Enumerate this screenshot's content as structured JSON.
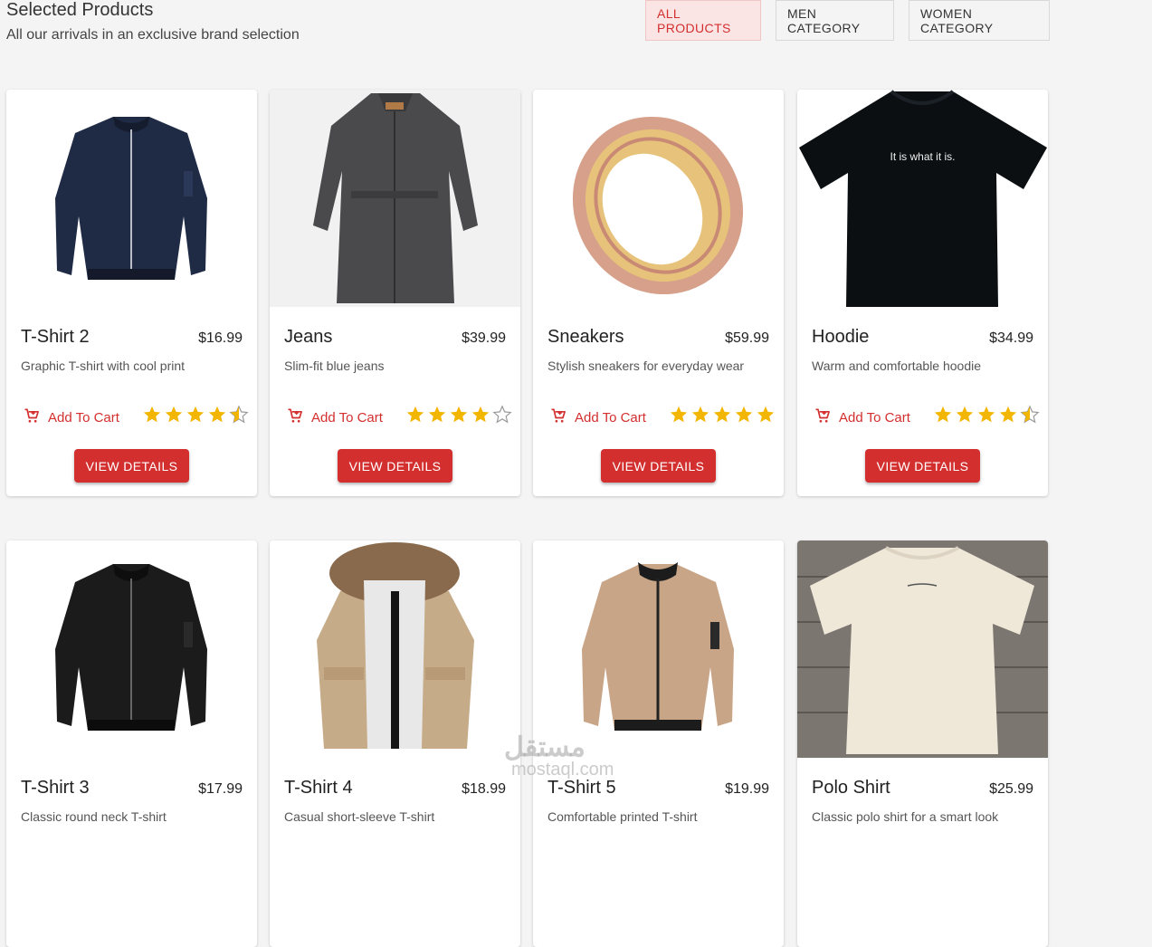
{
  "header": {
    "title": "Selected Products",
    "subtitle": "All our arrivals in an exclusive brand selection"
  },
  "tabs": [
    {
      "label": "ALL PRODUCTS",
      "active": true
    },
    {
      "label": "MEN CATEGORY",
      "active": false
    },
    {
      "label": "WOMEN CATEGORY",
      "active": false
    }
  ],
  "cart_label": "Add To Cart",
  "details_label": "VIEW DETAILS",
  "products": [
    {
      "name": "T-Shirt 2",
      "price": "$16.99",
      "description": "Graphic T-shirt with cool print",
      "rating": 4.5,
      "image": "navy-bomber-jacket"
    },
    {
      "name": "Jeans",
      "price": "$39.99",
      "description": "Slim-fit blue jeans",
      "rating": 4,
      "image": "denim-dress"
    },
    {
      "name": "Sneakers",
      "price": "$59.99",
      "description": "Stylish sneakers for everyday wear",
      "rating": 5,
      "image": "gold-ring"
    },
    {
      "name": "Hoodie",
      "price": "$34.99",
      "description": "Warm and comfortable hoodie",
      "rating": 4.5,
      "image": "black-tshirt",
      "image_text": "It is what it is."
    },
    {
      "name": "T-Shirt 3",
      "price": "$17.99",
      "description": "Classic round neck T-shirt",
      "rating": 0,
      "image": "black-bomber-jacket"
    },
    {
      "name": "T-Shirt 4",
      "price": "$18.99",
      "description": "Casual short-sleeve T-shirt",
      "rating": 0,
      "image": "fur-hood-parka"
    },
    {
      "name": "T-Shirt 5",
      "price": "$19.99",
      "description": "Comfortable printed T-shirt",
      "rating": 0,
      "image": "beige-bomber-jacket"
    },
    {
      "name": "Polo Shirt",
      "price": "$25.99",
      "description": "Classic polo shirt for a smart look",
      "rating": 0,
      "image": "cream-tshirt"
    }
  ],
  "watermark": {
    "text": "مستقل",
    "sub": "mostaql.com"
  },
  "colors": {
    "accent": "#d32f2f",
    "star": "#f2b600",
    "background": "#f4f4f4"
  }
}
